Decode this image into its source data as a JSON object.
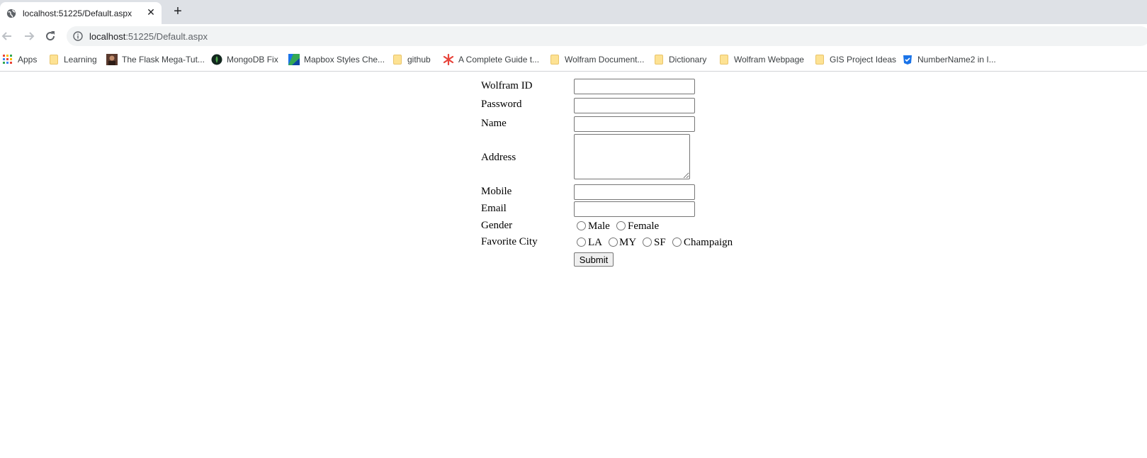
{
  "browser": {
    "tab": {
      "title": "localhost:51225/Default.aspx",
      "favicon": "globe-icon"
    },
    "address_bar": {
      "host": "localhost",
      "rest": ":51225/Default.aspx"
    },
    "bookmarks": [
      {
        "label": "Apps",
        "icon": "apps-grid-icon"
      },
      {
        "label": "Learning",
        "icon": "folder-icon"
      },
      {
        "label": "The Flask Mega-Tut...",
        "icon": "portrait-icon"
      },
      {
        "label": "MongoDB Fix",
        "icon": "mongodb-leaf-icon"
      },
      {
        "label": "Mapbox Styles Che...",
        "icon": "mapbox-icon"
      },
      {
        "label": "github",
        "icon": "folder-icon"
      },
      {
        "label": "A Complete Guide t...",
        "icon": "asterisk-icon"
      },
      {
        "label": "Wolfram Document...",
        "icon": "folder-icon"
      },
      {
        "label": "Dictionary",
        "icon": "folder-icon"
      },
      {
        "label": "Wolfram Webpage",
        "icon": "folder-icon"
      },
      {
        "label": "GIS Project Ideas",
        "icon": "folder-icon"
      },
      {
        "label": "NumberName2 in I...",
        "icon": "shield-icon"
      }
    ]
  },
  "form": {
    "labels": {
      "wolfram_id": "Wolfram ID",
      "password": "Password",
      "name": "Name",
      "address": "Address",
      "mobile": "Mobile",
      "email": "Email",
      "gender": "Gender",
      "favorite_city": "Favorite City"
    },
    "values": {
      "wolfram_id": "",
      "password": "",
      "name": "",
      "address": "",
      "mobile": "",
      "email": ""
    },
    "gender_options": [
      "Male",
      "Female"
    ],
    "city_options": [
      "LA",
      "MY",
      "SF",
      "Champaign"
    ],
    "submit_label": "Submit"
  }
}
